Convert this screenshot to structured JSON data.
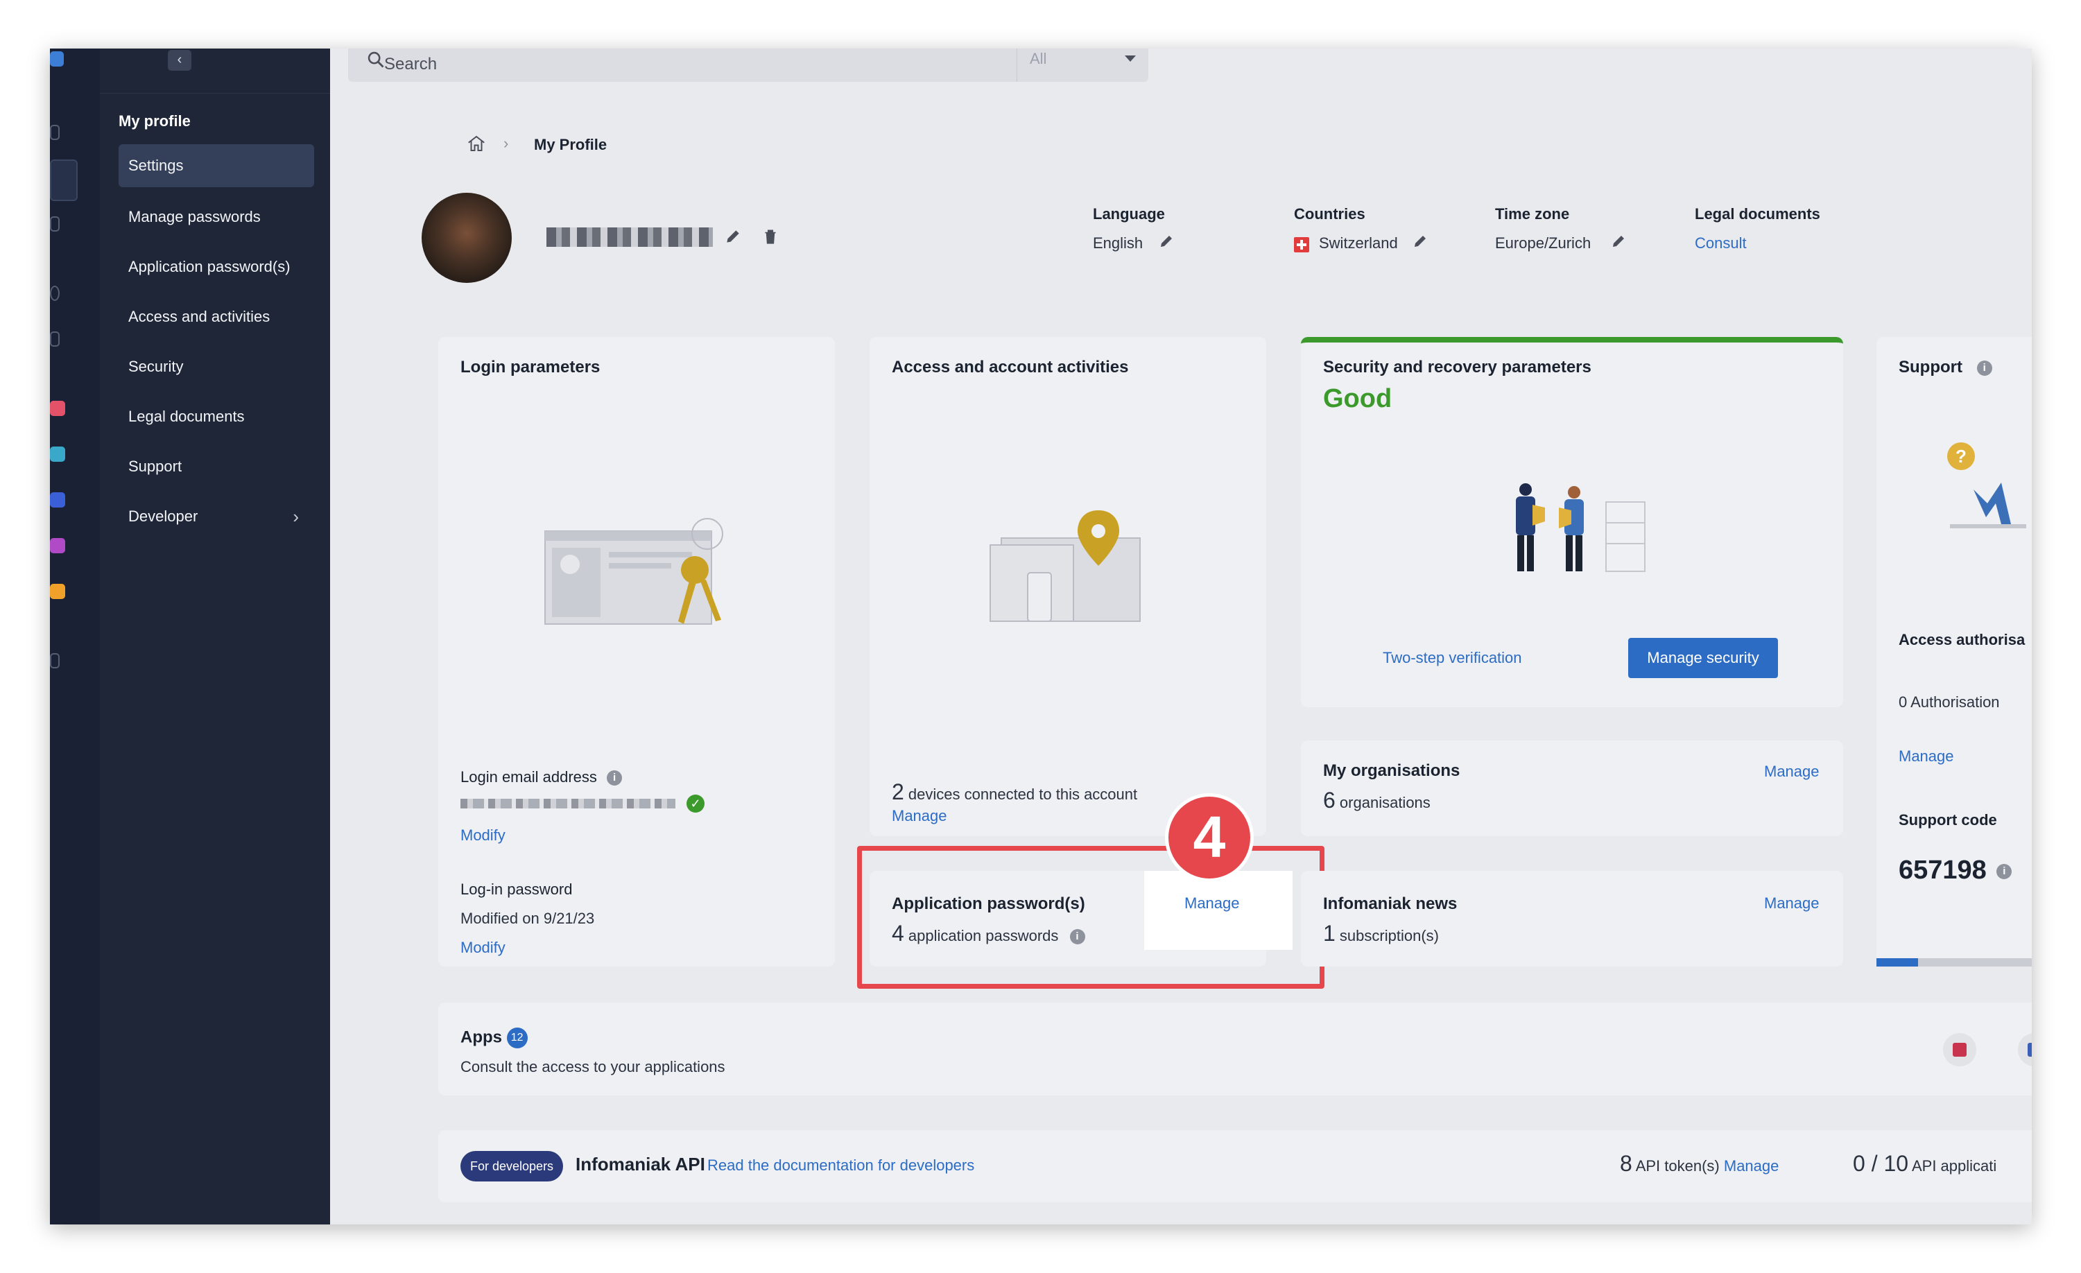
{
  "sidebar": {
    "title": "My profile",
    "items": [
      {
        "label": "Settings",
        "active": true
      },
      {
        "label": "Manage passwords"
      },
      {
        "label": "Application password(s)"
      },
      {
        "label": "Access and activities"
      },
      {
        "label": "Security"
      },
      {
        "label": "Legal documents"
      },
      {
        "label": "Support"
      },
      {
        "label": "Developer"
      }
    ]
  },
  "search": {
    "placeholder": "Search",
    "scope": "All"
  },
  "breadcrumb": {
    "current": "My Profile"
  },
  "profile": {
    "language": {
      "label": "Language",
      "value": "English"
    },
    "countries": {
      "label": "Countries",
      "value": "Switzerland"
    },
    "timezone": {
      "label": "Time zone",
      "value": "Europe/Zurich"
    },
    "legal": {
      "label": "Legal documents",
      "link": "Consult"
    }
  },
  "login": {
    "title": "Login parameters",
    "email_label": "Login email address",
    "email_modify": "Modify",
    "password_label": "Log-in password",
    "password_modified": "Modified on 9/21/23",
    "password_modify": "Modify"
  },
  "access": {
    "title": "Access and account activities",
    "devices_count": "2",
    "devices_text": "devices connected to this account",
    "manage": "Manage"
  },
  "app_passwords": {
    "title": "Application password(s)",
    "count": "4",
    "text": "application passwords",
    "manage": "Manage"
  },
  "security": {
    "title": "Security and recovery parameters",
    "status": "Good",
    "two_step": "Two-step verification",
    "manage_button": "Manage security"
  },
  "organisations": {
    "title": "My organisations",
    "count": "6",
    "text": "organisations",
    "manage": "Manage"
  },
  "news": {
    "title": "Infomaniak news",
    "count": "1",
    "text": "subscription(s)",
    "manage": "Manage"
  },
  "support": {
    "title": "Support",
    "access_label": "Access authorisa",
    "auth_text": "0 Authorisation",
    "manage": "Manage",
    "code_label": "Support code",
    "code": "657198"
  },
  "apps": {
    "title": "Apps",
    "badge": "12",
    "subtitle": "Consult the access to your applications"
  },
  "api": {
    "badge": "For developers",
    "title": "Infomaniak API",
    "doc_link": "Read the documentation for developers",
    "tokens_count": "8",
    "tokens_text": "API token(s)",
    "tokens_manage": "Manage",
    "apps_count": "0 / 10",
    "apps_text": "API applicati"
  },
  "step_badge": "4",
  "colors": {
    "accent": "#2c6cc4",
    "highlight": "#e5474d",
    "good": "#3c9a2c",
    "sidebar": "#1f2637"
  }
}
